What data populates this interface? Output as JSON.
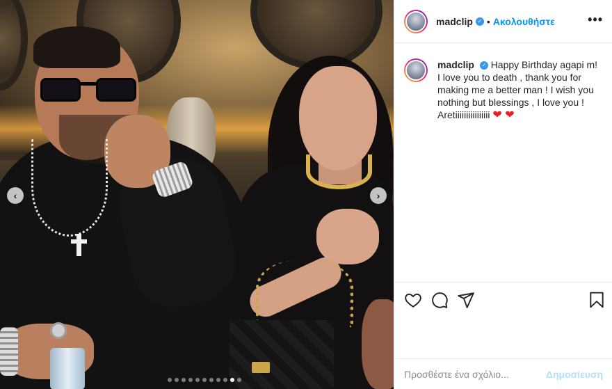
{
  "post": {
    "username": "madclip",
    "verified": true,
    "follow_label": "Ακολουθήστε",
    "separator": "•",
    "more_label": "•••"
  },
  "caption": {
    "username": "madclip",
    "text": "Happy Birthday agapi m! I love you to death , thank you for making me a better man ! I wish you nothing but blessings , I love you ! Aretiiiiiiiiiiiiiiii",
    "emoji": "❤ ❤"
  },
  "carousel": {
    "prev_label": "‹",
    "next_label": "›",
    "dot_count": 11,
    "active_dot": 9
  },
  "actions": {
    "icons": [
      "heart-icon",
      "comment-icon",
      "share-icon",
      "bookmark-icon"
    ]
  },
  "comment": {
    "placeholder": "Προσθέστε ένα σχόλιο...",
    "post_label": "Δημοσίευση"
  },
  "colors": {
    "accent": "#0095f6",
    "verified": "#3897f0",
    "post_disabled": "#b2dffc",
    "heart": "#ed1c24"
  }
}
